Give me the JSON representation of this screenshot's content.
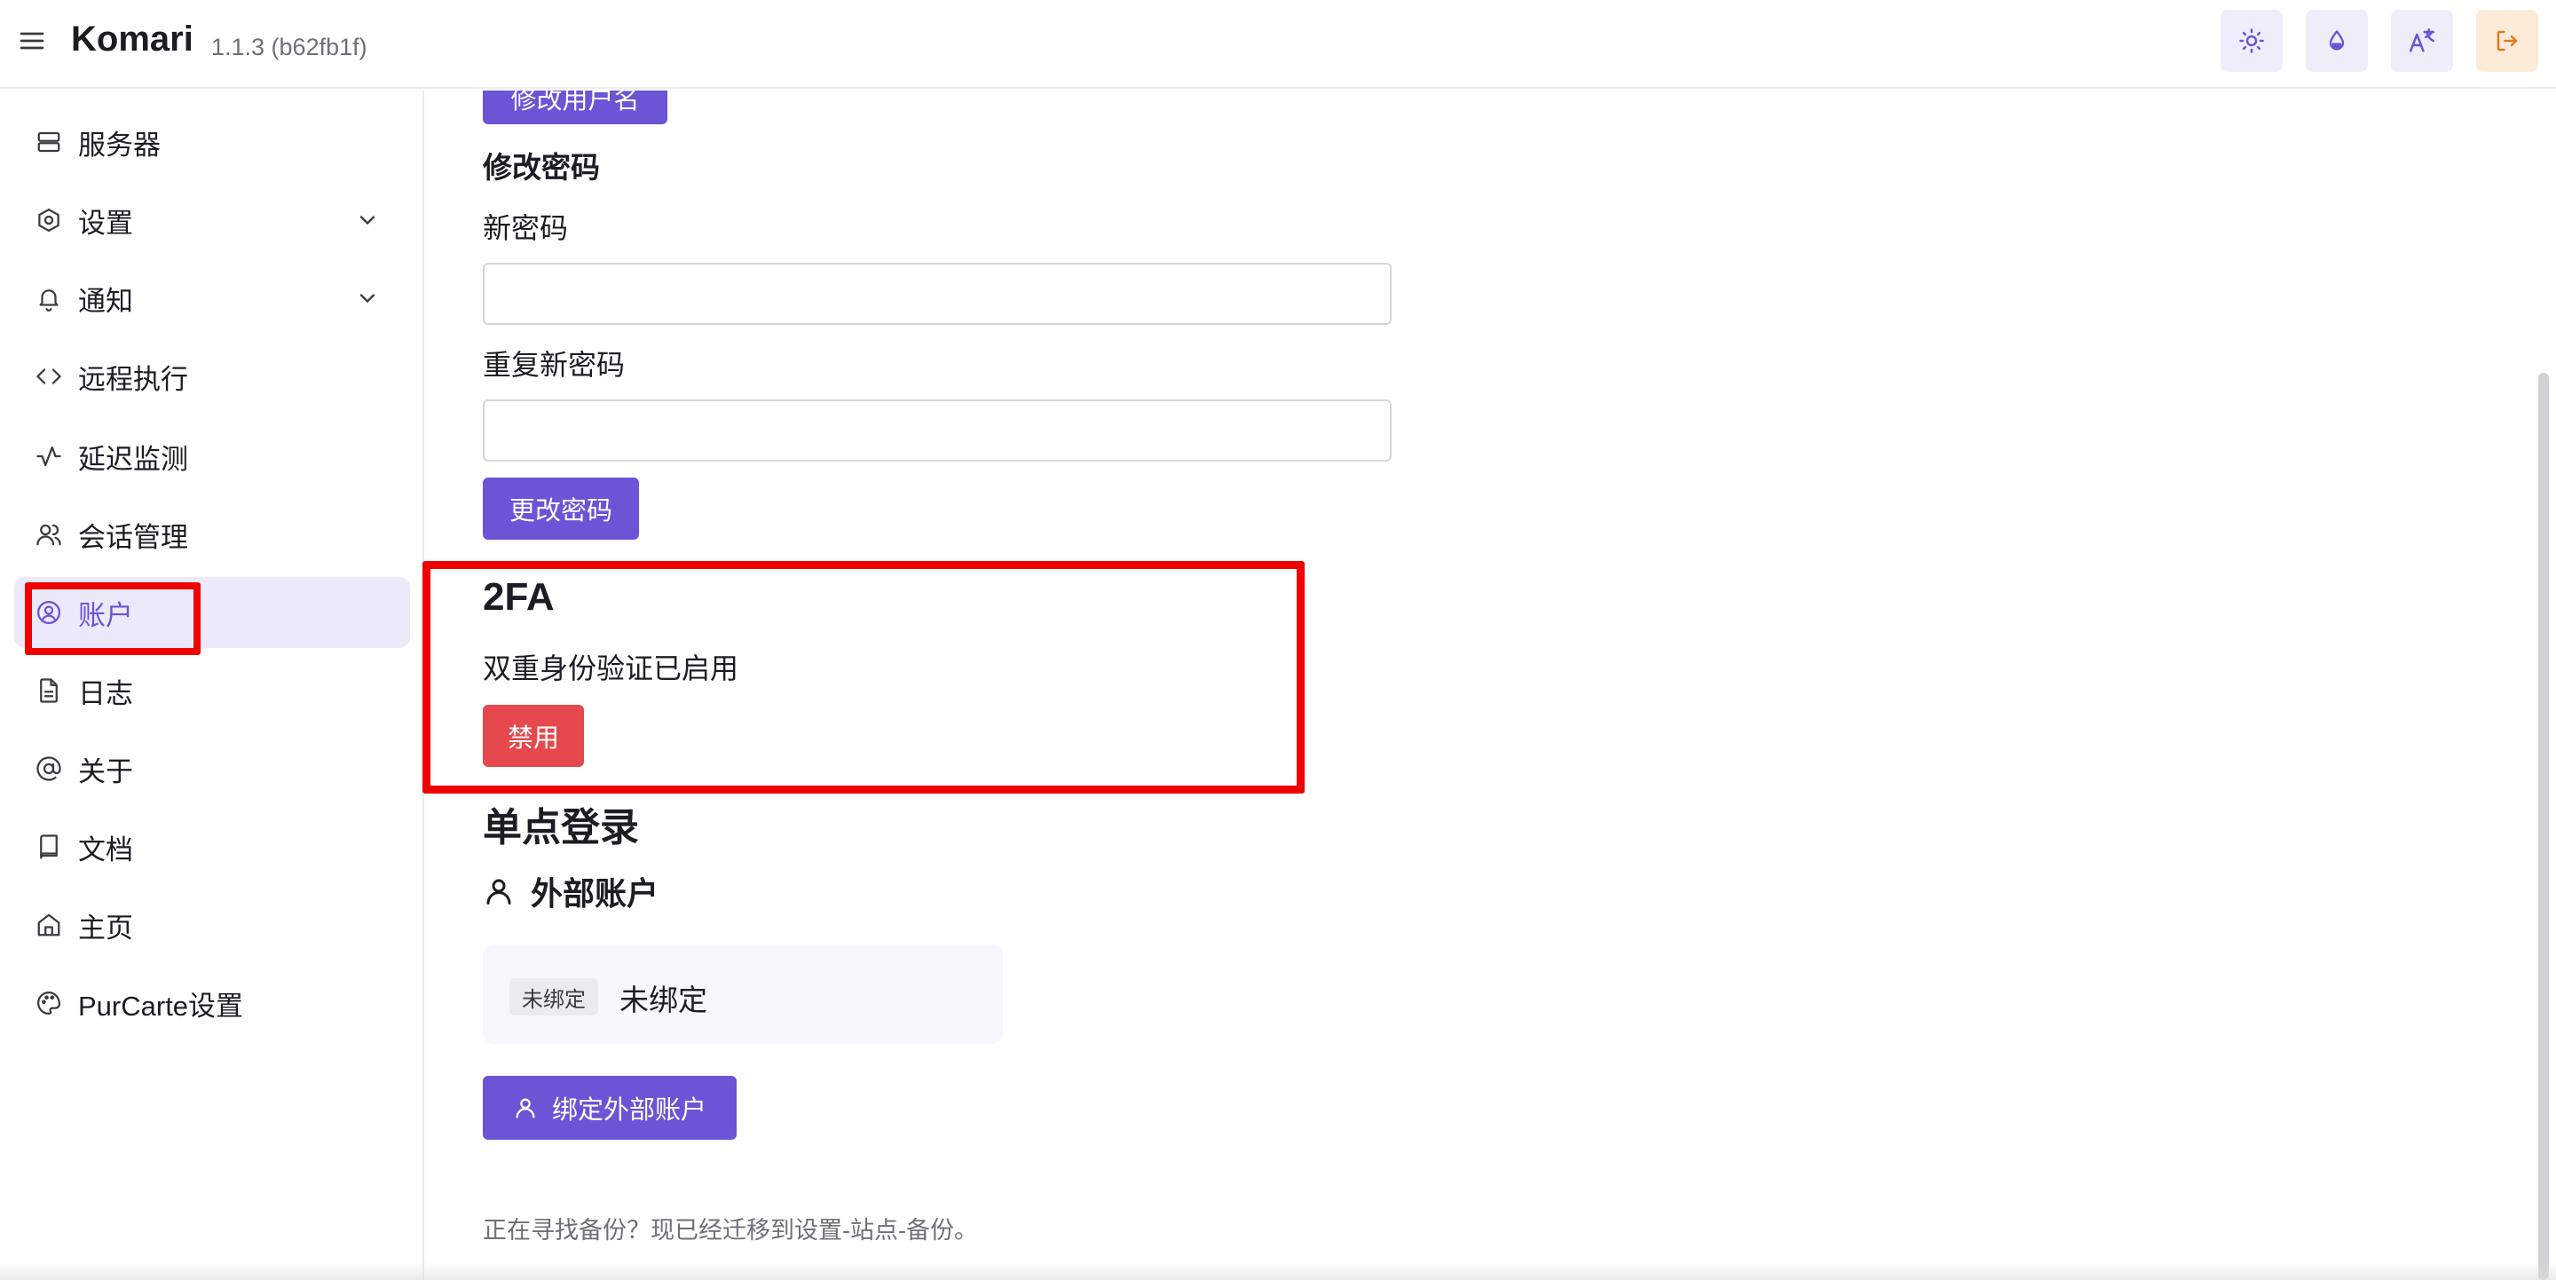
{
  "header": {
    "brand": "Komari",
    "version": "1.1.3 (b62fb1f)"
  },
  "sidebar": {
    "items": [
      {
        "label": "服务器",
        "icon": "server-icon"
      },
      {
        "label": "设置",
        "icon": "settings-hexagon-icon",
        "expandable": true
      },
      {
        "label": "通知",
        "icon": "bell-icon",
        "expandable": true
      },
      {
        "label": "远程执行",
        "icon": "code-icon"
      },
      {
        "label": "延迟监测",
        "icon": "activity-icon"
      },
      {
        "label": "会话管理",
        "icon": "users-icon"
      },
      {
        "label": "账户",
        "icon": "user-circle-icon",
        "active": true
      },
      {
        "label": "日志",
        "icon": "file-text-icon"
      },
      {
        "label": "关于",
        "icon": "at-sign-icon"
      },
      {
        "label": "文档",
        "icon": "book-icon"
      },
      {
        "label": "主页",
        "icon": "home-icon"
      },
      {
        "label": "PurCarte设置",
        "icon": "palette-icon"
      }
    ]
  },
  "main": {
    "change_username_button": "修改用户名",
    "password_section_title": "修改密码",
    "new_password_label": "新密码",
    "repeat_password_label": "重复新密码",
    "new_password_value": "",
    "repeat_password_value": "",
    "change_password_button": "更改密码",
    "twofa_title": "2FA",
    "twofa_status": "双重身份验证已启用",
    "disable_button": "禁用",
    "sso_title": "单点登录",
    "external_accounts_title": "外部账户",
    "unbound_tag": "未绑定",
    "unbound_text": "未绑定",
    "bind_button": "绑定外部账户",
    "backup_note": "正在寻找备份？现已经迁移到设置-站点-备份。"
  },
  "colors": {
    "accent": "#6b54d6",
    "danger": "#e5484d",
    "highlight": "#f00000"
  }
}
